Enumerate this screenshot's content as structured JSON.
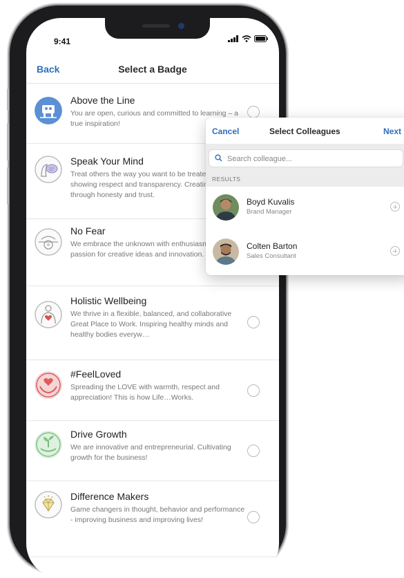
{
  "status_bar": {
    "time": "9:41"
  },
  "nav": {
    "back_label": "Back",
    "title": "Select a Badge"
  },
  "badges": [
    {
      "title": "Above the Line",
      "description": "You are open, curious and committed to learning – a true inspiration!",
      "icon": "above-the-line-icon",
      "color": "#5b8fd6"
    },
    {
      "title": "Speak Your Mind",
      "description": "Treat others the way you want to be treated, always showing respect and transparency. Creating value through honesty and trust.",
      "icon": "speak-your-mind-icon",
      "color": "#c9c9c9"
    },
    {
      "title": "No Fear",
      "description": "We embrace the unknown with enthusiasm and passion for creative ideas and innovation.",
      "icon": "no-fear-icon",
      "color": "#c9c9c9"
    },
    {
      "title": "Holistic Wellbeing",
      "description": "We thrive in a flexible, balanced, and collaborative Great Place to Work. Inspiring healthy minds and healthy bodies everyw…",
      "icon": "holistic-wellbeing-icon",
      "color": "#d9534f"
    },
    {
      "title": "#FeelLoved",
      "description": "Spreading the LOVE with warmth, respect and appreciation!  This is how Life…Works.",
      "icon": "feel-loved-icon",
      "color": "#e05c5c"
    },
    {
      "title": "Drive Growth",
      "description": "We are innovative and entrepreneurial. Cultivating growth for the business!",
      "icon": "drive-growth-icon",
      "color": "#7cc47f"
    },
    {
      "title": "Difference Makers",
      "description": "Game changers in thought, behavior and performance - improving business and improving lives!",
      "icon": "difference-makers-icon",
      "color": "#e8c14a"
    }
  ],
  "colleagues": {
    "cancel_label": "Cancel",
    "title": "Select Colleagues",
    "next_label": "Next",
    "search_placeholder": "Search colleague...",
    "results_label": "RESULTS",
    "people": [
      {
        "name": "Boyd Kuvalis",
        "role": "Brand Manager"
      },
      {
        "name": "Colten Barton",
        "role": "Sales Consultant"
      }
    ]
  },
  "colors": {
    "accent": "#2f6fb8",
    "divider": "#e6e6e6"
  }
}
